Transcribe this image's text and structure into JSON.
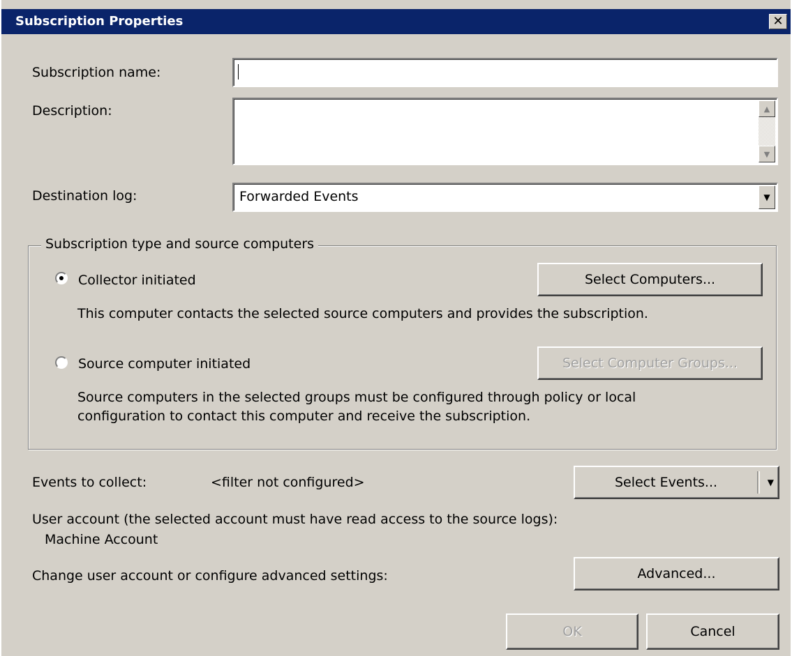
{
  "window": {
    "title": "Subscription Properties",
    "close_glyph": "✕"
  },
  "form": {
    "subscription_name_label": "Subscription name:",
    "subscription_name_value": "",
    "description_label": "Description:",
    "description_value": "",
    "destination_log_label": "Destination log:",
    "destination_log_value": "Forwarded Events"
  },
  "subscription_type": {
    "legend": "Subscription type and source computers",
    "collector": {
      "label": "Collector initiated",
      "selected": true,
      "button": "Select Computers...",
      "description": "This computer contacts the selected source computers and provides the subscription."
    },
    "source": {
      "label": "Source computer initiated",
      "selected": false,
      "button": "Select Computer Groups...",
      "description_line1": "Source computers in the selected groups must be configured through policy or local",
      "description_line2": "configuration to contact this computer and receive the subscription."
    }
  },
  "events": {
    "label": "Events to collect:",
    "value": "<filter not configured>",
    "button": "Select Events..."
  },
  "account": {
    "label": "User account (the selected account must have read access to the source logs):",
    "value": "Machine Account",
    "advanced_label": "Change user account or configure advanced settings:",
    "advanced_button": "Advanced..."
  },
  "footer": {
    "ok": "OK",
    "cancel": "Cancel"
  },
  "icons": {
    "scroll_up": "▲",
    "scroll_down": "▼",
    "dropdown": "▼"
  },
  "colors": {
    "titlebar": "#0a246a",
    "face": "#d4d0c8",
    "disabled_text": "#a0a0a0"
  }
}
